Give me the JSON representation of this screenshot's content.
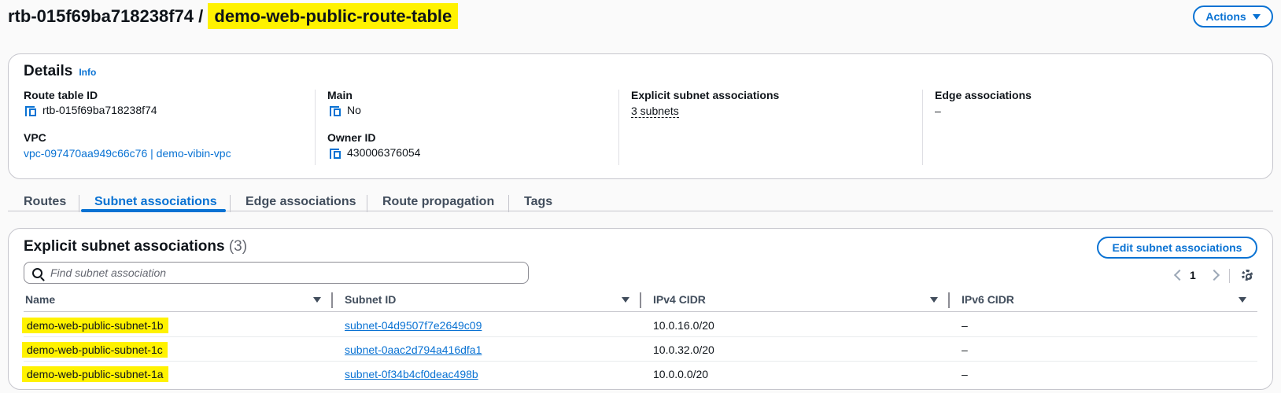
{
  "header": {
    "route_table_id": "rtb-015f69ba718238f74",
    "separator": " / ",
    "route_table_name": "demo-web-public-route-table",
    "actions_label": "Actions"
  },
  "details": {
    "title": "Details",
    "info_label": "Info",
    "route_table_id_label": "Route table ID",
    "route_table_id_value": "rtb-015f69ba718238f74",
    "vpc_label": "VPC",
    "vpc_value": "vpc-097470aa949c66c76 | demo-vibin-vpc",
    "main_label": "Main",
    "main_value": "No",
    "owner_id_label": "Owner ID",
    "owner_id_value": "430006376054",
    "explicit_label": "Explicit subnet associations",
    "explicit_value": "3 subnets",
    "edge_label": "Edge associations",
    "edge_value": "–"
  },
  "tabs": [
    {
      "label": "Routes",
      "active": false
    },
    {
      "label": "Subnet associations",
      "active": true
    },
    {
      "label": "Edge associations",
      "active": false
    },
    {
      "label": "Route propagation",
      "active": false
    },
    {
      "label": "Tags",
      "active": false
    }
  ],
  "subnet_section": {
    "title": "Explicit subnet associations",
    "count": "(3)",
    "edit_label": "Edit subnet associations",
    "search_placeholder": "Find subnet association",
    "page_number": "1",
    "columns": [
      "Name",
      "Subnet ID",
      "IPv4 CIDR",
      "IPv6 CIDR"
    ],
    "rows": [
      {
        "name": "demo-web-public-subnet-1b",
        "subnet_id": "subnet-04d9507f7e2649c09",
        "ipv4": "10.0.16.0/20",
        "ipv6": "–"
      },
      {
        "name": "demo-web-public-subnet-1c",
        "subnet_id": "subnet-0aac2d794a416dfa1",
        "ipv4": "10.0.32.0/20",
        "ipv6": "–"
      },
      {
        "name": "demo-web-public-subnet-1a",
        "subnet_id": "subnet-0f34b4cf0deac498b",
        "ipv4": "10.0.0.0/20",
        "ipv6": "–"
      }
    ]
  },
  "colors": {
    "link": "#0972d3",
    "highlight": "#fff200"
  }
}
